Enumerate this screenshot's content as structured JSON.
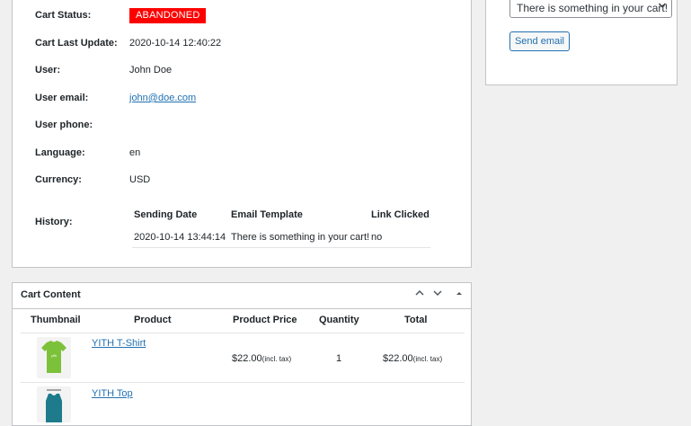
{
  "cart_info": {
    "rows": [
      {
        "label": "Cart Status:",
        "value": "ABANDONED"
      },
      {
        "label": "Cart Last Update:",
        "value": "2020-10-14 12:40:22"
      },
      {
        "label": "User:",
        "value": "John Doe"
      },
      {
        "label": "User email:",
        "value": "john@doe.com"
      },
      {
        "label": "User phone:",
        "value": ""
      },
      {
        "label": "Language:",
        "value": "en"
      },
      {
        "label": "Currency:",
        "value": "USD"
      },
      {
        "label": "History:",
        "value": ""
      }
    ],
    "status_color": "#ff0000",
    "history": {
      "columns": [
        "Sending Date",
        "Email Template",
        "Link Clicked"
      ],
      "rows": [
        {
          "date": "2020-10-14 13:44:14",
          "template": "There is something in your cart!",
          "clicked": "no"
        }
      ]
    }
  },
  "side": {
    "template_select": "There is something in your cart!",
    "send_label": "Send email"
  },
  "cart_content": {
    "title": "Cart Content",
    "columns": [
      "Thumbnail",
      "Product",
      "Product Price",
      "Quantity",
      "Total"
    ],
    "items": [
      {
        "product": "YITH T-Shirt",
        "price": "$22.00",
        "price_note": "(incl. tax)",
        "quantity": "1",
        "total": "$22.00",
        "total_note": "(incl. tax)",
        "thumb_color": "#7cc13a"
      },
      {
        "product": "YITH Top",
        "thumb_color": "#1d7b8c"
      }
    ]
  }
}
